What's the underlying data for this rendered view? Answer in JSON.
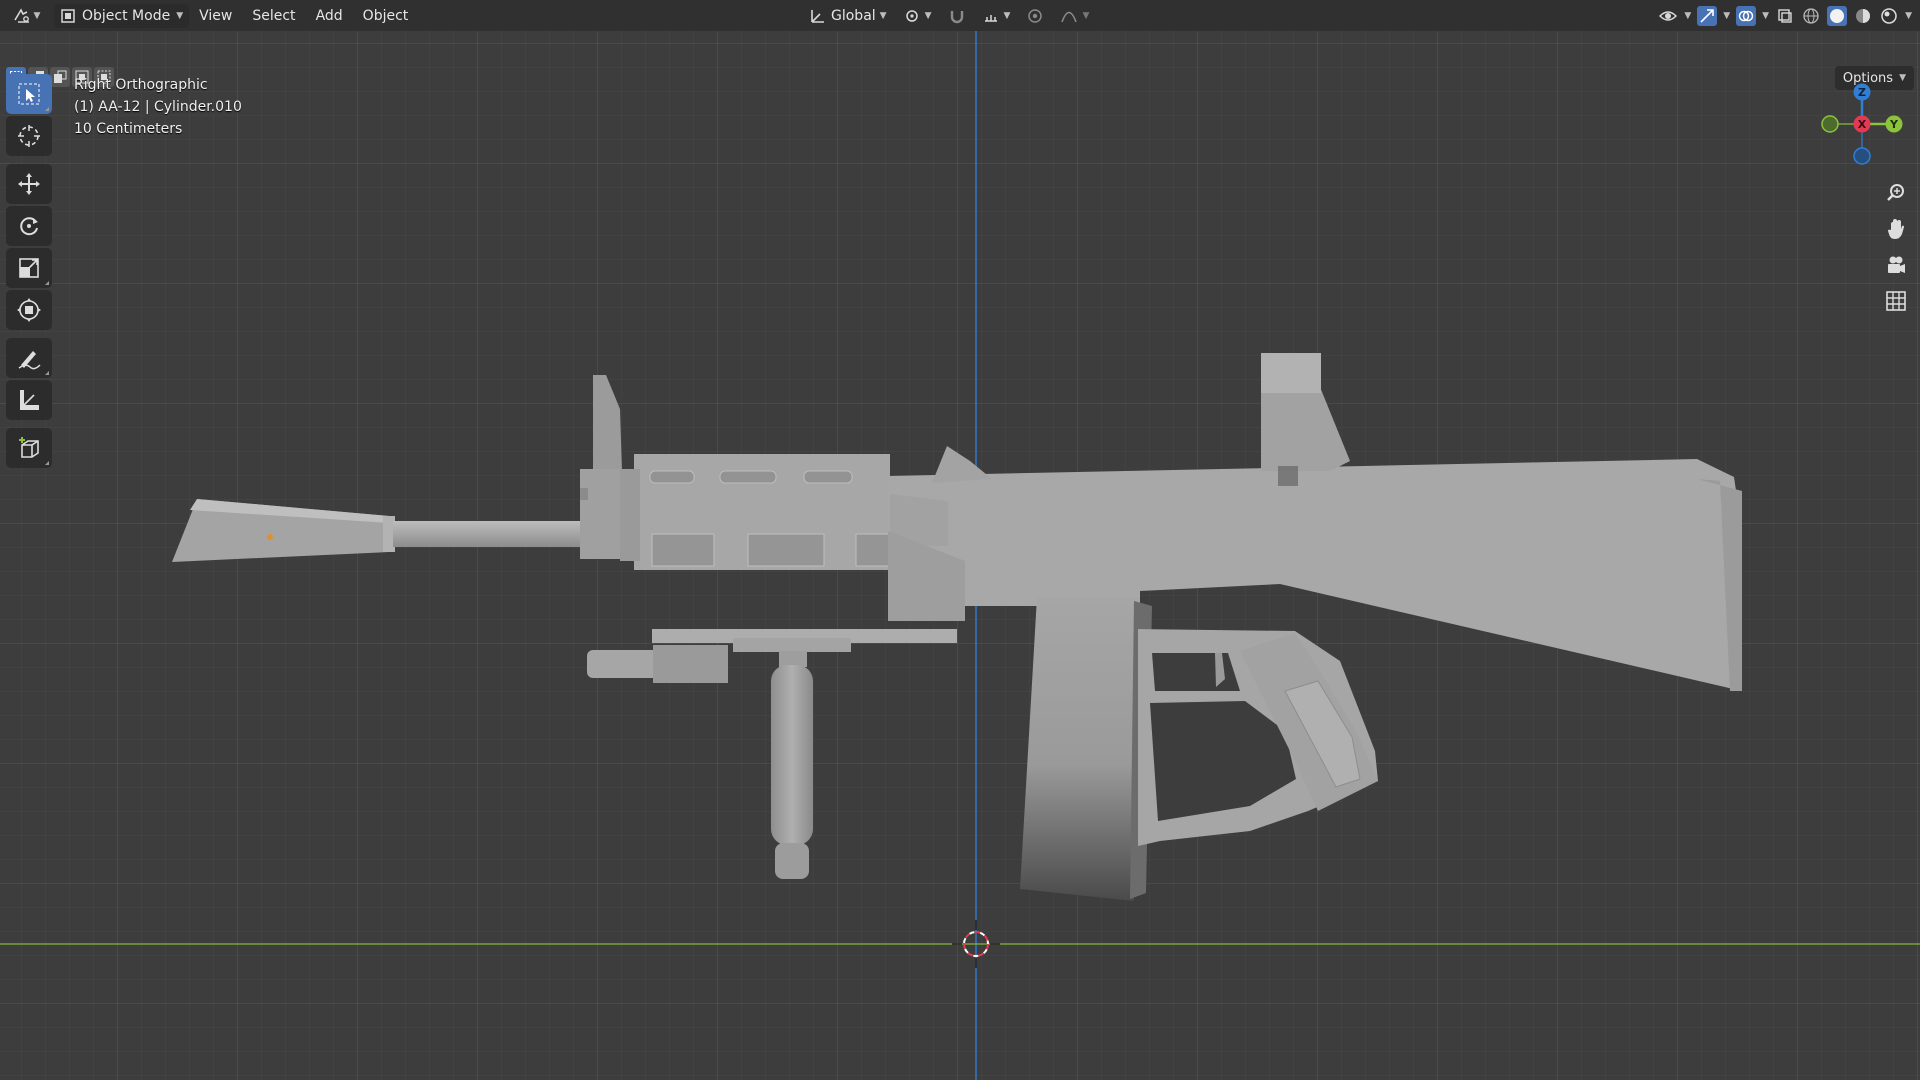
{
  "header": {
    "mode": "Object Mode",
    "menus": [
      "View",
      "Select",
      "Add",
      "Object"
    ],
    "transform_orientation": "Global"
  },
  "viewport": {
    "options_label": "Options",
    "info_lines": [
      "Right Orthographic",
      "(1) AA-12 | Cylinder.010",
      "10 Centimeters"
    ]
  },
  "gizmo": {
    "z_label": "Z",
    "x_label": "X",
    "y_label": "Y"
  },
  "colors": {
    "accent": "#4772b3",
    "axis_x": "#e23a52",
    "axis_y": "#8bc33b",
    "axis_z": "#2f7fd6",
    "model": "#a8a8a8"
  },
  "toolbar": [
    "select-box",
    "cursor",
    "move",
    "rotate",
    "scale",
    "transform",
    "annotate",
    "measure",
    "add-cube"
  ]
}
